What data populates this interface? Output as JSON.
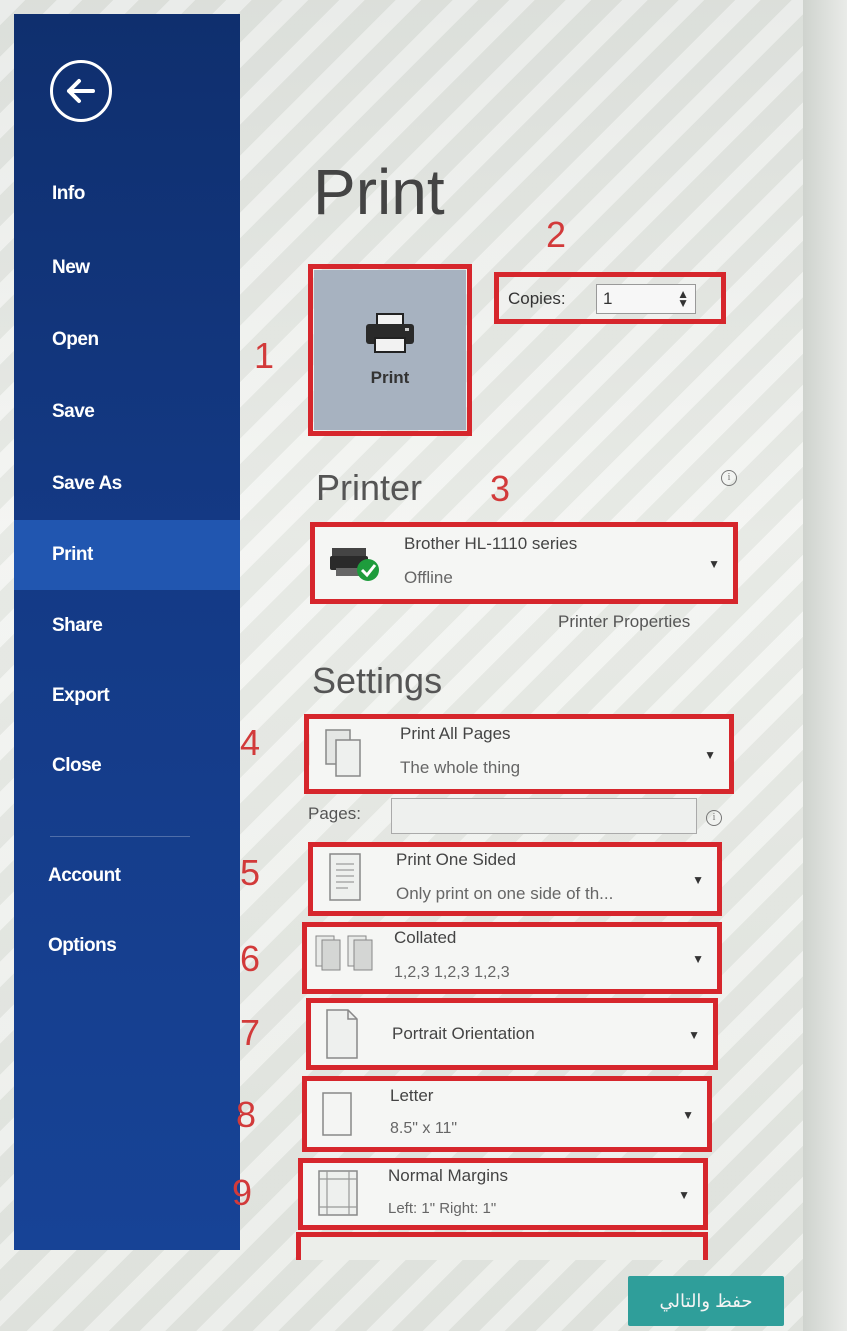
{
  "sidebar": {
    "items": [
      {
        "label": "Info"
      },
      {
        "label": "New"
      },
      {
        "label": "Open"
      },
      {
        "label": "Save"
      },
      {
        "label": "Save As"
      },
      {
        "label": "Print"
      },
      {
        "label": "Share"
      },
      {
        "label": "Export"
      },
      {
        "label": "Close"
      },
      {
        "label": "Account"
      },
      {
        "label": "Options"
      }
    ],
    "active": "Print"
  },
  "main": {
    "title": "Print",
    "print_button_label": "Print",
    "copies": {
      "label": "Copies:",
      "value": "1"
    },
    "printer": {
      "heading": "Printer",
      "name": "Brother HL-1110 series",
      "status": "Offline",
      "properties_link": "Printer Properties"
    },
    "settings": {
      "heading": "Settings",
      "pages_label": "Pages:",
      "pages_value": "",
      "print_range": {
        "title": "Print All Pages",
        "subtitle": "The whole thing"
      },
      "sides": {
        "title": "Print One Sided",
        "subtitle": "Only print on one side of th..."
      },
      "collation": {
        "title": "Collated",
        "subtitle": "1,2,3    1,2,3    1,2,3"
      },
      "orientation": {
        "title": "Portrait Orientation"
      },
      "paper": {
        "title": "Letter",
        "subtitle": "8.5\" x 11\""
      },
      "margins": {
        "title": "Normal Margins",
        "subtitle": "Left: 1\"   Right: 1\""
      }
    }
  },
  "annotations": [
    "1",
    "2",
    "3",
    "4",
    "5",
    "6",
    "7",
    "8",
    "9"
  ],
  "bottom_button": {
    "label": "حفظ والتالي"
  },
  "colors": {
    "sidebar": "#143a86",
    "sidebar_active": "#2156b0",
    "annotation": "#d6262c",
    "teal_button": "#2f9e9a"
  }
}
